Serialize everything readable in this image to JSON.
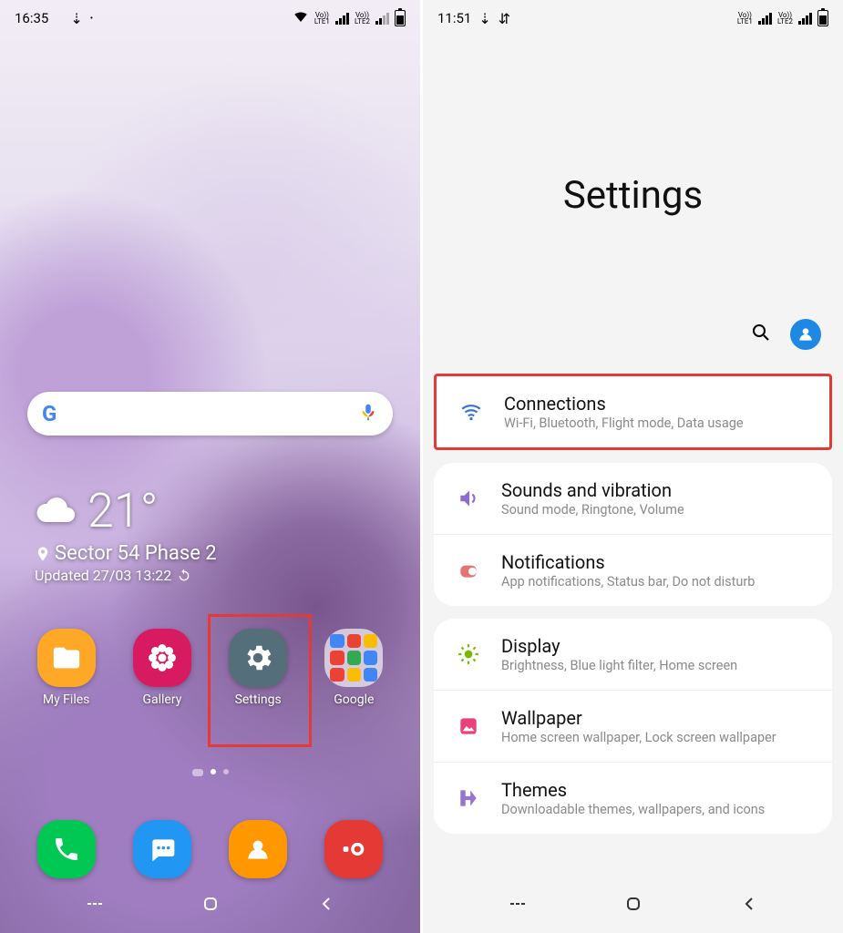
{
  "home": {
    "status": {
      "time": "16:35",
      "lte1": "LTE1",
      "lte2": "LTE2",
      "vo": "Vo))"
    },
    "weather": {
      "temp": "21°",
      "location": "Sector 54 Phase 2",
      "updated": "Updated 27/03 13:22"
    },
    "apps": [
      {
        "label": "My Files"
      },
      {
        "label": "Gallery"
      },
      {
        "label": "Settings"
      },
      {
        "label": "Google"
      }
    ]
  },
  "settings": {
    "status": {
      "time": "11:51",
      "lte1": "LTE1",
      "lte2": "LTE2",
      "vo": "Vo))"
    },
    "title": "Settings",
    "items": [
      {
        "title": "Connections",
        "sub": "Wi-Fi, Bluetooth, Flight mode, Data usage"
      },
      {
        "title": "Sounds and vibration",
        "sub": "Sound mode, Ringtone, Volume"
      },
      {
        "title": "Notifications",
        "sub": "App notifications, Status bar, Do not disturb"
      },
      {
        "title": "Display",
        "sub": "Brightness, Blue light filter, Home screen"
      },
      {
        "title": "Wallpaper",
        "sub": "Home screen wallpaper, Lock screen wallpaper"
      },
      {
        "title": "Themes",
        "sub": "Downloadable themes, wallpapers, and icons"
      }
    ]
  }
}
